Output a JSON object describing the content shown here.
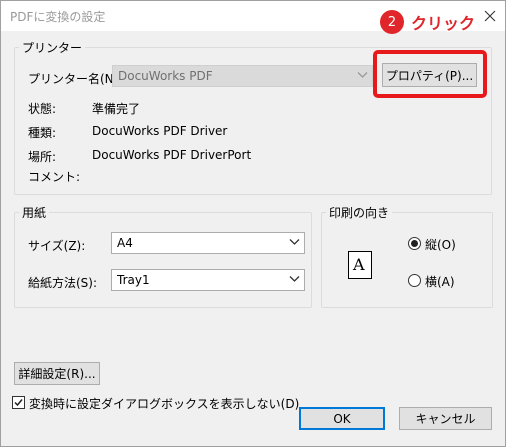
{
  "window": {
    "title": "PDFに変換の設定"
  },
  "printer": {
    "legend": "プリンター",
    "name_label": "プリンター名(N):",
    "name_value": "DocuWorks PDF",
    "properties_button": "プロパティ(P)...",
    "status_label": "状態:",
    "status_value": "準備完了",
    "type_label": "種類:",
    "type_value": "DocuWorks PDF Driver",
    "location_label": "場所:",
    "location_value": "DocuWorks PDF DriverPort",
    "comment_label": "コメント:",
    "comment_value": ""
  },
  "paper": {
    "legend": "用紙",
    "size_label": "サイズ(Z):",
    "size_value": "A4",
    "source_label": "給紙方法(S):",
    "source_value": "Tray1"
  },
  "orientation": {
    "legend": "印刷の向き",
    "icon_letter": "A",
    "portrait_label": "縦(O)",
    "landscape_label": "横(A)",
    "selected": "portrait"
  },
  "footer": {
    "advanced_button": "詳細設定(R)...",
    "dont_show_label": "変換時に設定ダイアログボックスを表示しない(D)",
    "dont_show_checked": true,
    "ok_button": "OK",
    "cancel_button": "キャンセル"
  },
  "annotation": {
    "step_number": "2",
    "step_text": "クリック",
    "color": "#e8191b"
  }
}
